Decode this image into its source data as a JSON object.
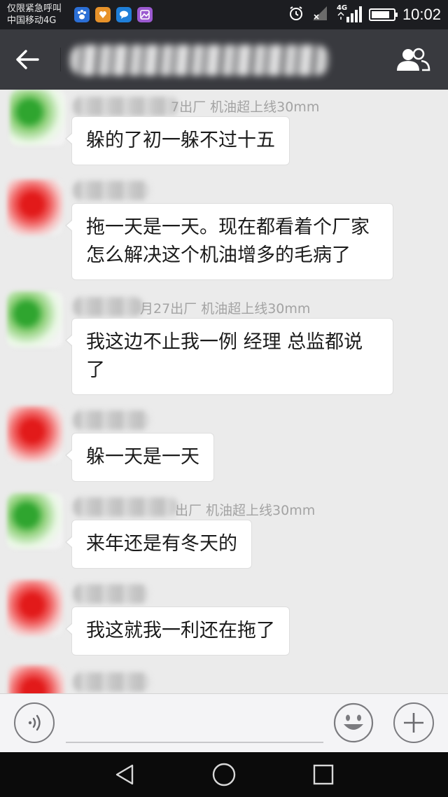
{
  "status_bar": {
    "carrier_line1": "仅限紧急呼叫",
    "carrier_line2": "中国移动4G",
    "network_label": "4G",
    "time": "10:02",
    "battery_level": 0.85
  },
  "header": {
    "back_icon": "back-arrow-icon",
    "group_icon": "group-members-icon"
  },
  "messages": [
    {
      "name_suffix": "7出厂 机油超上线30mm",
      "text": "躲的了初一躲不过十五",
      "avatar_color": "green"
    },
    {
      "name_suffix": "",
      "text": "拖一天是一天。现在都看着个厂家怎么解决这个机油增多的毛病了",
      "avatar_color": "red"
    },
    {
      "name_suffix": "月27出厂 机油超上线30mm",
      "text": "我这边不止我一例 经理 总监都说了",
      "avatar_color": "green"
    },
    {
      "name_suffix": "",
      "text": "躲一天是一天",
      "avatar_color": "red"
    },
    {
      "name_suffix": "出厂 机油超上线30mm",
      "text": "来年还是有冬天的",
      "avatar_color": "green"
    },
    {
      "name_suffix": "",
      "text": "我这就我一利还在拖了",
      "avatar_color": "red"
    },
    {
      "name_suffix": "",
      "text": "",
      "avatar_color": "red"
    }
  ],
  "input_bar": {
    "voice_icon": "voice-input-icon",
    "emoji_icon": "emoji-icon",
    "plus_icon": "plus-icon"
  },
  "nav_bar": {
    "back_icon": "nav-back-icon",
    "home_icon": "nav-home-icon",
    "recents_icon": "nav-recents-icon"
  }
}
